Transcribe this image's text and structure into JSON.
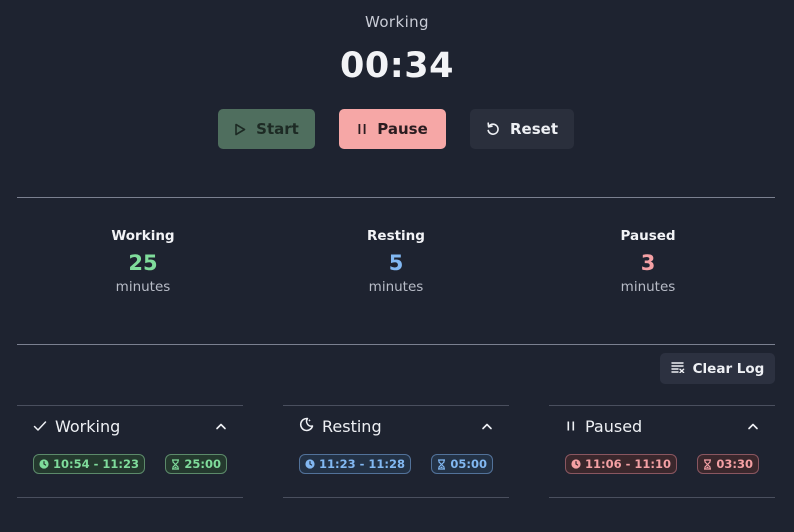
{
  "header": {
    "status": "Working",
    "timer": "00:34"
  },
  "controls": {
    "start_label": "Start",
    "pause_label": "Pause",
    "reset_label": "Reset"
  },
  "stats": {
    "working": {
      "title": "Working",
      "value": "25",
      "unit": "minutes",
      "color": "#7fdc9b"
    },
    "resting": {
      "title": "Resting",
      "value": "5",
      "unit": "minutes",
      "color": "#82b8f2"
    },
    "paused": {
      "title": "Paused",
      "value": "3",
      "unit": "minutes",
      "color": "#f4a0a4"
    }
  },
  "log": {
    "clear_label": "Clear Log",
    "panels": [
      {
        "title": "Working",
        "icon": "check-icon",
        "range": "10:54 - 11:23",
        "duration": "25:00",
        "color": "#7fdc9b"
      },
      {
        "title": "Resting",
        "icon": "moon-icon",
        "range": "11:23 - 11:28",
        "duration": "05:00",
        "color": "#82b8f2"
      },
      {
        "title": "Paused",
        "icon": "pause-icon",
        "range": "11:06 - 11:10",
        "duration": "03:30",
        "color": "#f4a0a4"
      }
    ]
  }
}
